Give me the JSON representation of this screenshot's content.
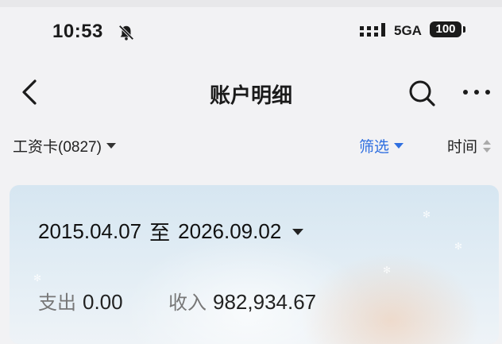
{
  "status": {
    "time": "10:53",
    "network": "5GA",
    "battery": "100"
  },
  "nav": {
    "title": "账户明细"
  },
  "filterbar": {
    "account": "工资卡(0827)",
    "filter": "筛选",
    "sort": "时间"
  },
  "card": {
    "date_start": "2015.04.07",
    "date_sep": "至",
    "date_end": "2026.09.02",
    "expense_label": "支出",
    "expense_value": "0.00",
    "income_label": "收入",
    "income_value": "982,934.67"
  },
  "icons": {
    "mute": "bell-off-icon",
    "signal": "cellular-signal-icon",
    "back": "chevron-left-icon",
    "search": "search-icon",
    "more": "more-horizontal-icon",
    "sort": "sort-updown-icon"
  },
  "colors": {
    "accent": "#2f6fe0",
    "background": "#f2f2f4",
    "card_top": "#d6e6f1"
  }
}
